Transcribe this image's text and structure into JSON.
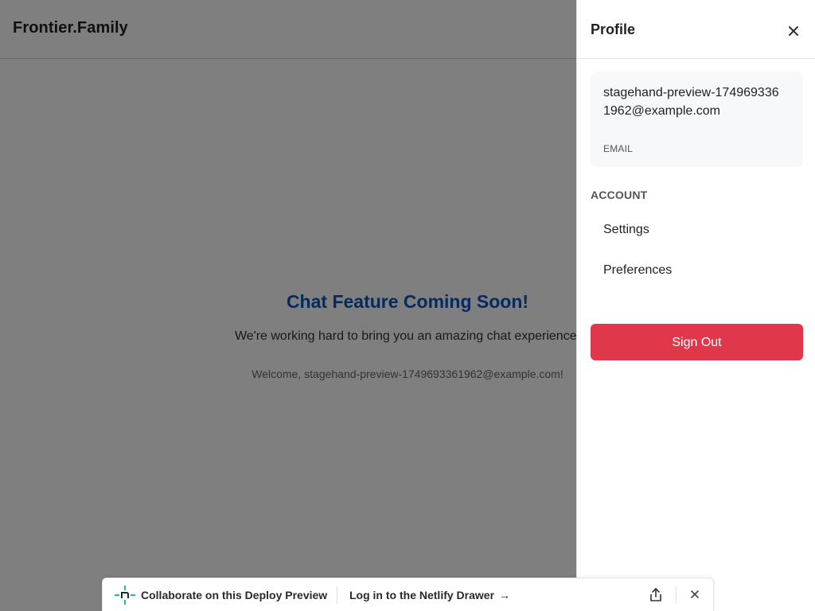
{
  "header": {
    "brand": "Frontier.Family"
  },
  "main": {
    "title": "Chat Feature Coming Soon!",
    "description": "We're working hard to bring you an amazing chat experience!",
    "welcome": "Welcome, stagehand-preview-1749693361962@example.com!"
  },
  "drawer": {
    "title": "Profile",
    "close_icon": "close-icon",
    "email_value": "stagehand-preview-1749693361962@example.com",
    "email_label": "EMAIL",
    "section_label": "ACCOUNT",
    "menu": [
      {
        "label": "Settings"
      },
      {
        "label": "Preferences"
      }
    ],
    "sign_out_label": "Sign Out",
    "sign_out_color": "#e0374a"
  },
  "netlify_bar": {
    "logo_icon": "netlify-logo-icon",
    "collaborate_label": "Collaborate on this Deploy Preview",
    "login_label": "Log in to the Netlify Drawer",
    "login_arrow": "→",
    "share_icon": "share-icon",
    "close_icon": "close-icon"
  },
  "colors": {
    "title_blue": "#0d55b6",
    "overlay": "rgba(0,0,0,0.5)",
    "netlify_teal": "#2bb5a2"
  }
}
